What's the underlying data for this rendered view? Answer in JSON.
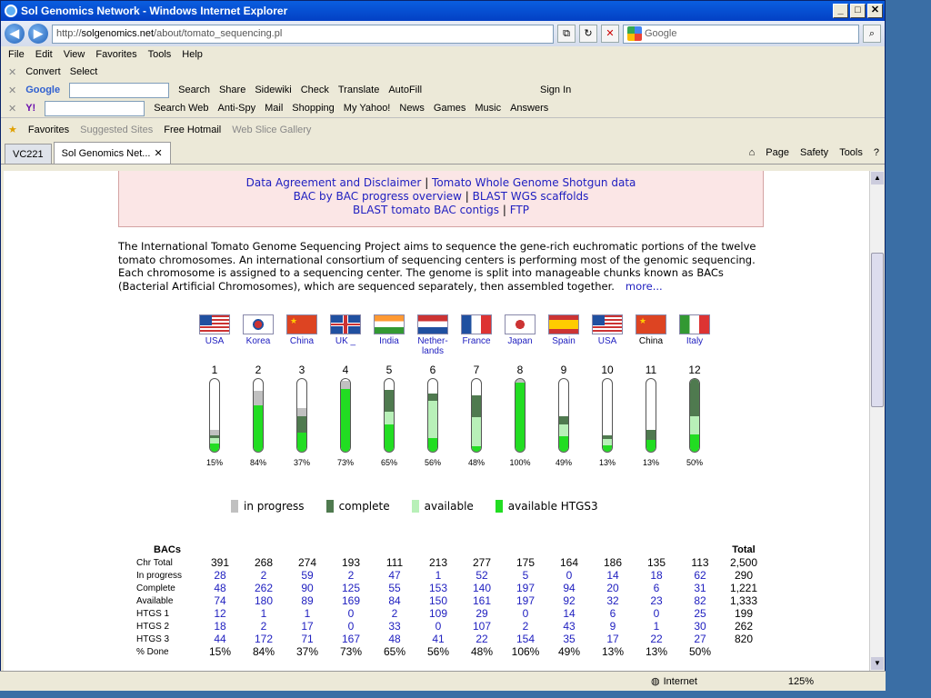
{
  "window": {
    "title": "Sol Genomics Network - Windows Internet Explorer"
  },
  "address": {
    "prefix": "http://",
    "host": "solgenomics.net",
    "path": "/about/tomato_sequencing.pl"
  },
  "search": {
    "placeholder": "Google"
  },
  "menu": [
    "File",
    "Edit",
    "View",
    "Favorites",
    "Tools",
    "Help"
  ],
  "toolbar1": [
    "Convert",
    "Select"
  ],
  "toolbar2": [
    "Google",
    "Search",
    "Share",
    "Sidewiki",
    "Check",
    "Translate",
    "AutoFill",
    "Sign In"
  ],
  "toolbar3": [
    "Search Web",
    "Anti-Spy",
    "Mail",
    "Shopping",
    "My Yahoo!",
    "News",
    "Games",
    "Music",
    "Answers"
  ],
  "favorites": {
    "label": "Favorites",
    "items": [
      "Suggested Sites",
      "Free Hotmail",
      "Web Slice Gallery"
    ]
  },
  "tabs": [
    {
      "label": "VC221"
    },
    {
      "label": "Sol Genomics Net..."
    }
  ],
  "tabtools": [
    "Page",
    "Safety",
    "Tools"
  ],
  "links": {
    "line1a": "Data Agreement and Disclaimer",
    "line1b": "Tomato Whole Genome Shotgun data",
    "line2a": "BAC by BAC progress overview",
    "line2b": "BLAST WGS scaffolds",
    "line3a": "BLAST tomato BAC contigs",
    "line3b": "FTP",
    "sep": " | "
  },
  "intro": "The International Tomato Genome Sequencing Project aims to sequence the gene-rich euchromatic portions of the twelve tomato chromosomes. An international consortium of sequencing centers is performing most of the genomic sequencing. Each chromosome is assigned to a sequencing center. The genome is split into manageable chunks known as BACs (Bacterial Artificial Chromosomes), which are sequenced separately, then assembled together.",
  "more": "more...",
  "centers": [
    {
      "label": "USA",
      "flag": "usa",
      "linked": true
    },
    {
      "label": "Korea",
      "flag": "korea",
      "linked": true
    },
    {
      "label": "China",
      "flag": "china",
      "linked": true
    },
    {
      "label": "UK _",
      "flag": "uk",
      "linked": true
    },
    {
      "label": "India",
      "flag": "india",
      "linked": true
    },
    {
      "label": "Nether- lands",
      "flag": "netherlands",
      "linked": true
    },
    {
      "label": "France",
      "flag": "france",
      "linked": true
    },
    {
      "label": "Japan",
      "flag": "japan",
      "linked": true
    },
    {
      "label": "Spain",
      "flag": "spain",
      "linked": true
    },
    {
      "label": "USA",
      "flag": "usa",
      "linked": true
    },
    {
      "label": "China",
      "flag": "china",
      "linked": false
    },
    {
      "label": "Italy",
      "flag": "italy",
      "linked": true
    }
  ],
  "chart_data": {
    "type": "bar",
    "categories": [
      "1",
      "2",
      "3",
      "4",
      "5",
      "6",
      "7",
      "8",
      "9",
      "10",
      "11",
      "12"
    ],
    "percent_labels": [
      "15%",
      "84%",
      "37%",
      "73%",
      "65%",
      "56%",
      "48%",
      "100%",
      "49%",
      "13%",
      "13%",
      "50%"
    ],
    "series": [
      {
        "name": "available HTGS3",
        "values": [
          0.11,
          0.64,
          0.26,
          0.86,
          0.37,
          0.19,
          0.08,
          0.95,
          0.21,
          0.09,
          0.16,
          0.24
        ]
      },
      {
        "name": "available",
        "values": [
          0.08,
          0.0,
          0.0,
          0.0,
          0.18,
          0.51,
          0.4,
          0.0,
          0.17,
          0.08,
          0.0,
          0.25
        ]
      },
      {
        "name": "complete",
        "values": [
          0.04,
          0.0,
          0.23,
          0.0,
          0.3,
          0.1,
          0.3,
          0.0,
          0.11,
          0.05,
          0.14,
          0.51
        ]
      },
      {
        "name": "in progress",
        "values": [
          0.07,
          0.2,
          0.11,
          0.11,
          0.0,
          0.0,
          0.0,
          0.05,
          0.0,
          0.0,
          0.0,
          0.0
        ]
      }
    ],
    "colors": {
      "in progress": "#c0c0c0",
      "complete": "#4f7a4f",
      "available": "#b8f0b8",
      "available HTGS3": "#22dd22"
    }
  },
  "legend": [
    "in progress",
    "complete",
    "available",
    "available HTGS3"
  ],
  "table": {
    "title": "BACs",
    "total_header": "Total",
    "rows": [
      {
        "label": "Chr Total",
        "blue": false,
        "values": [
          "391",
          "268",
          "274",
          "193",
          "111",
          "213",
          "277",
          "175",
          "164",
          "186",
          "135",
          "113"
        ],
        "total": "2,500"
      },
      {
        "label": "In progress",
        "blue": true,
        "values": [
          "28",
          "2",
          "59",
          "2",
          "47",
          "1",
          "52",
          "5",
          "0",
          "14",
          "18",
          "62"
        ],
        "total": "290"
      },
      {
        "label": "Complete",
        "blue": true,
        "values": [
          "48",
          "262",
          "90",
          "125",
          "55",
          "153",
          "140",
          "197",
          "94",
          "20",
          "6",
          "31"
        ],
        "total": "1,221"
      },
      {
        "label": "Available",
        "blue": true,
        "values": [
          "74",
          "180",
          "89",
          "169",
          "84",
          "150",
          "161",
          "197",
          "92",
          "32",
          "23",
          "82"
        ],
        "total": "1,333"
      },
      {
        "label": "HTGS 1",
        "blue": true,
        "values": [
          "12",
          "1",
          "1",
          "0",
          "2",
          "109",
          "29",
          "0",
          "14",
          "6",
          "0",
          "25"
        ],
        "total": "199"
      },
      {
        "label": "HTGS 2",
        "blue": true,
        "values": [
          "18",
          "2",
          "17",
          "0",
          "33",
          "0",
          "107",
          "2",
          "43",
          "9",
          "1",
          "30"
        ],
        "total": "262"
      },
      {
        "label": "HTGS 3",
        "blue": true,
        "values": [
          "44",
          "172",
          "71",
          "167",
          "48",
          "41",
          "22",
          "154",
          "35",
          "17",
          "22",
          "27"
        ],
        "total": "820"
      },
      {
        "label": "% Done",
        "blue": false,
        "values": [
          "15%",
          "84%",
          "37%",
          "73%",
          "65%",
          "56%",
          "48%",
          "106%",
          "49%",
          "13%",
          "13%",
          "50%"
        ],
        "total": ""
      }
    ]
  },
  "status": {
    "zone": "Internet",
    "zoom": "125%"
  }
}
